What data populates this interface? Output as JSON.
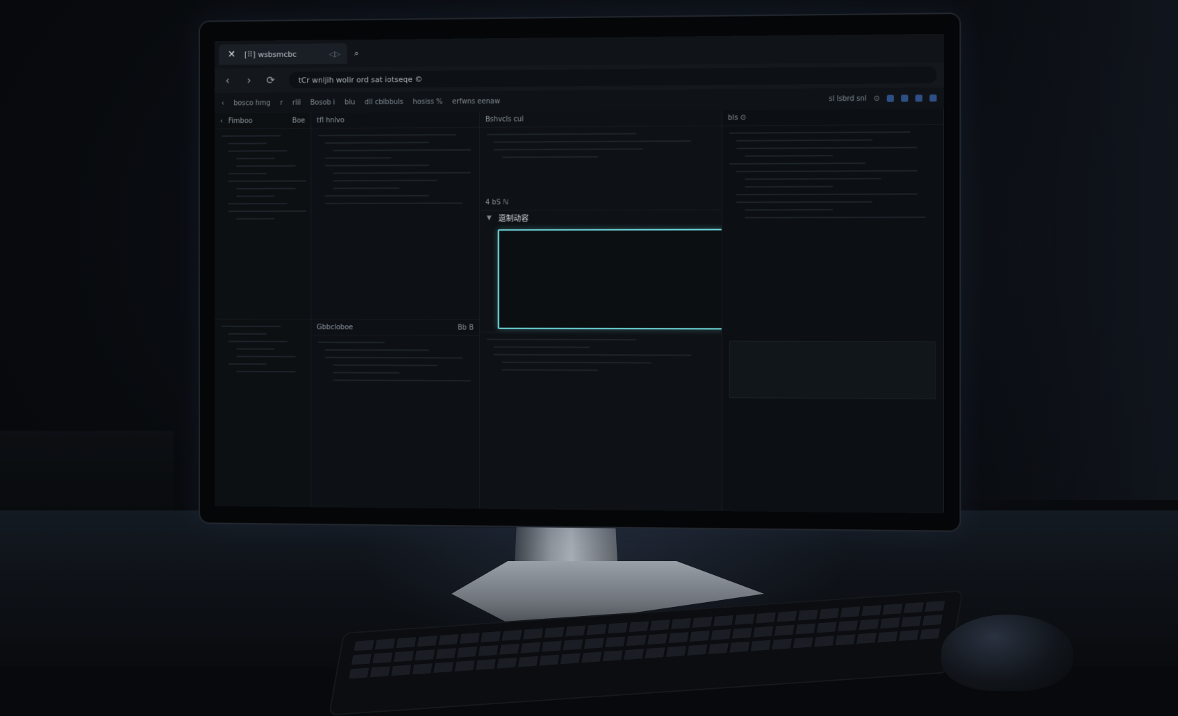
{
  "browser": {
    "tab": {
      "title": "[⠿] wsbsmcbc",
      "aux": "◁▷"
    },
    "address": {
      "url": "tCr wnljih wolir ord sat iotseqe ©"
    }
  },
  "ide": {
    "toolbar": {
      "items": [
        "bosco hmg",
        "r",
        "rlil",
        "Bosob i",
        "blu",
        "dll cblbbuls",
        "hosiss %",
        "erfwns eenaw"
      ],
      "right": [
        "sl lsbrd snl",
        "⊙"
      ]
    },
    "explorer": {
      "title": "Fimboo",
      "subtitle": "Boe"
    },
    "editor": {
      "title": "tfl hnlvo",
      "bottom_title": "Gbbcloboe",
      "bottom_aux": "Bb B"
    },
    "center": {
      "title": "Bshvcls cul",
      "section": "4 bS ℕ",
      "prompt_label": "逗制动容",
      "input_value": ""
    },
    "right_panel": {
      "title": "bls ⊙"
    }
  }
}
